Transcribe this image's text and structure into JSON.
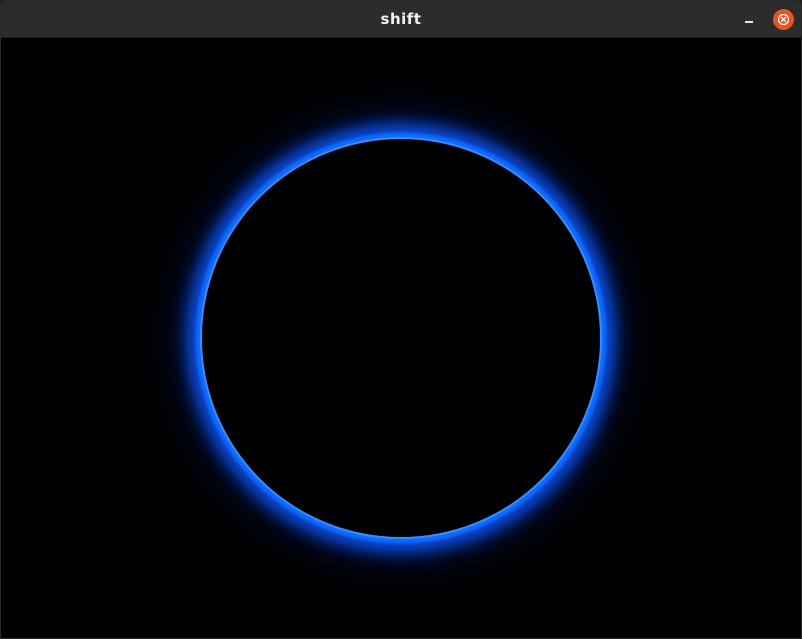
{
  "window": {
    "title": "shift",
    "minimize_icon": "minimize-icon",
    "close_icon": "close-icon",
    "close_color": "#e95420"
  },
  "scene": {
    "background_color": "#000000",
    "ring_color": "#0a6cff",
    "glow_color": "#0040c0"
  }
}
